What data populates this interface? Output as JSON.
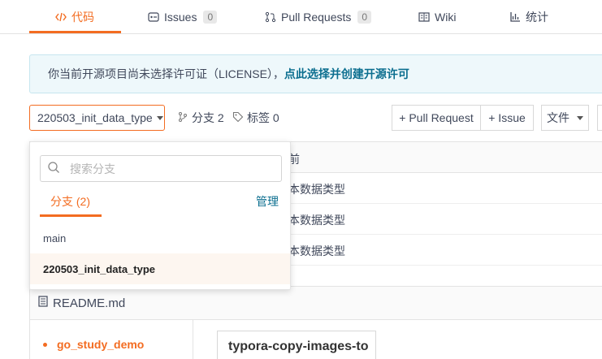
{
  "tabs": [
    {
      "label": "代码",
      "icon": "code-icon"
    },
    {
      "label": "Issues",
      "icon": "issues-icon",
      "count": "0"
    },
    {
      "label": "Pull Requests",
      "icon": "pull-request-icon",
      "count": "0"
    },
    {
      "label": "Wiki",
      "icon": "wiki-icon"
    },
    {
      "label": "统计",
      "icon": "stats-icon"
    }
  ],
  "banner": {
    "text": "你当前开源项目尚未选择许可证（LICENSE），",
    "link": "点此选择并创建开源许可"
  },
  "branch_selector": {
    "current": "220503_init_data_type"
  },
  "repo_meta": {
    "branches_label": "分支 2",
    "tags_label": "标签 0"
  },
  "actions": {
    "pull_request": "+ Pull Request",
    "issue": "+ Issue",
    "file": "文件"
  },
  "commits": {
    "header_fragment": "前",
    "rows": [
      "本数据类型",
      "本数据类型",
      "本数据类型"
    ]
  },
  "dropdown": {
    "search_placeholder": "搜索分支",
    "tab_label": "分支 (2)",
    "manage_label": "管理",
    "branches": [
      "main",
      "220503_init_data_type"
    ],
    "selected_index": 1
  },
  "readme": {
    "title": "README.md",
    "toc_item": "go_study_demo",
    "doc_heading": "typora-copy-images-to"
  },
  "colors": {
    "accent": "#f36c21",
    "link": "#0b6e8f",
    "banner_bg": "#eef8fb"
  }
}
